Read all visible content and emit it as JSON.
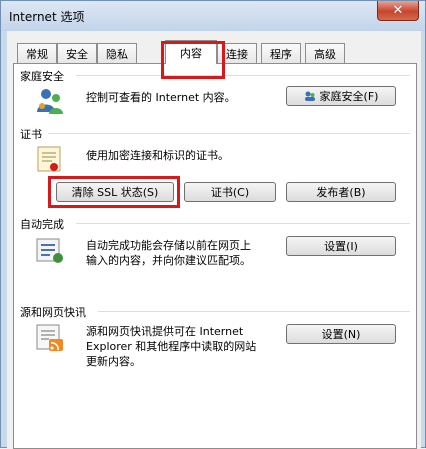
{
  "window": {
    "title": "Internet 选项",
    "close_glyph": "✕"
  },
  "tabs": [
    {
      "label": "常规"
    },
    {
      "label": "安全"
    },
    {
      "label": "隐私"
    },
    {
      "label": "内容"
    },
    {
      "label": "连接"
    },
    {
      "label": "程序"
    },
    {
      "label": "高级"
    }
  ],
  "active_tab": "内容",
  "family_safety": {
    "title": "家庭安全",
    "description": "控制可查看的 Internet 内容。",
    "button_label": "家庭安全(F)"
  },
  "certificates": {
    "title": "证书",
    "description": "使用加密连接和标识的证书。",
    "clear_ssl_label": "清除 SSL 状态(S)",
    "certificates_label": "证书(C)",
    "publishers_label": "发布者(B)"
  },
  "autocomplete": {
    "title": "自动完成",
    "description_line1": "自动完成功能会存储以前在网页上",
    "description_line2": "输入的内容，并向你建议匹配项。",
    "button_label": "设置(I)"
  },
  "feeds": {
    "title": "源和网页快讯",
    "description_line1": "源和网页快讯提供可在 Internet",
    "description_line2": "Explorer 和其他程序中读取的网站",
    "description_line3": "更新内容。",
    "button_label": "设置(N)"
  },
  "colors": {
    "highlight": "#d7191c",
    "title_bar": "#c3d4ea"
  }
}
